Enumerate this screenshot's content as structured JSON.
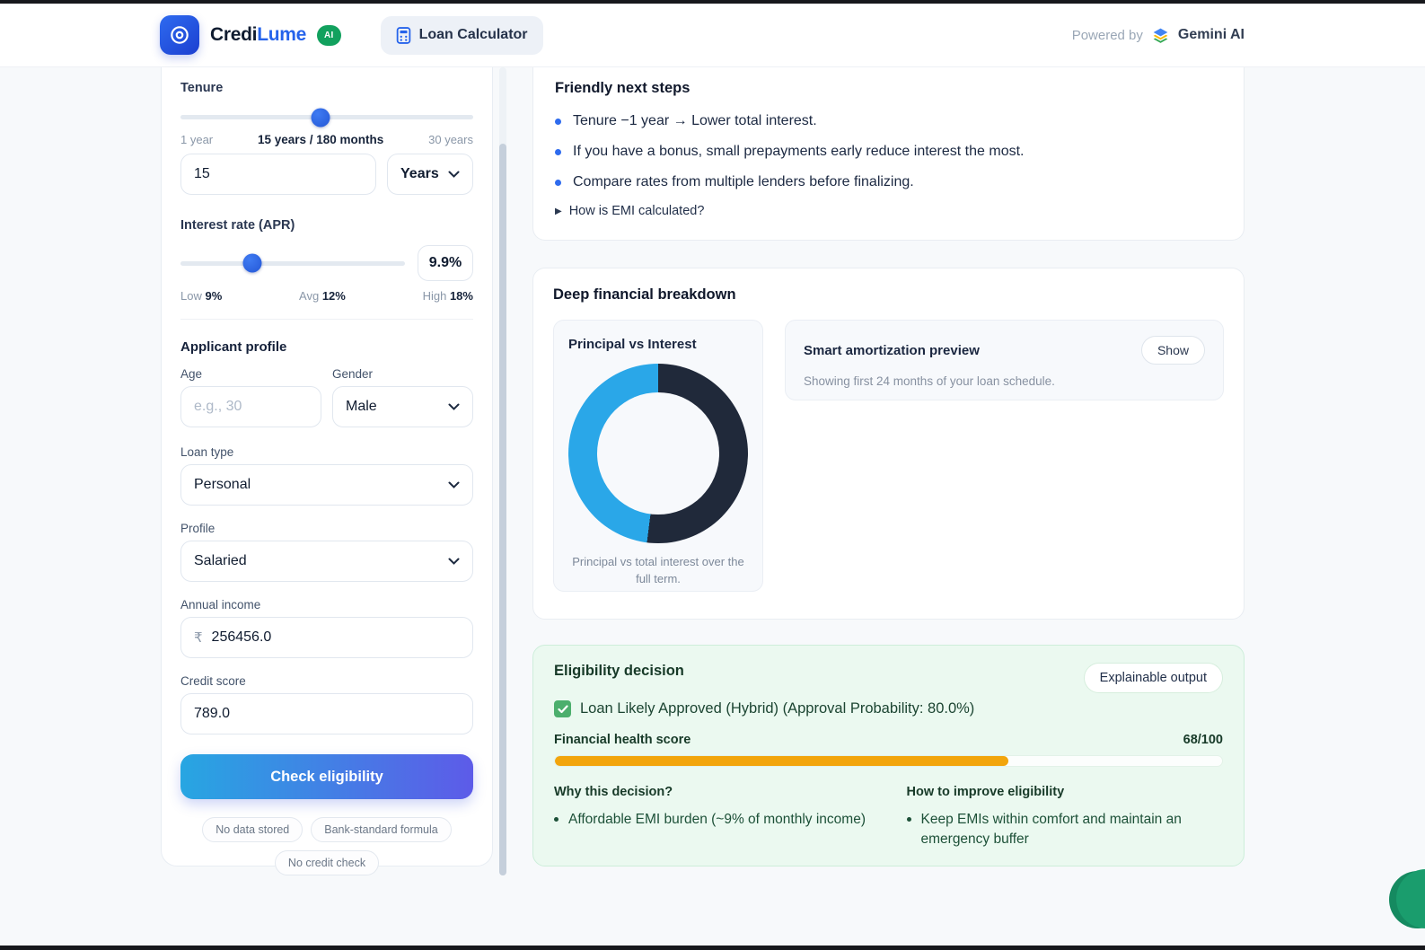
{
  "header": {
    "brand": {
      "name_primary": "Credi",
      "name_secondary": "Lume",
      "badge": "AI"
    },
    "tab": {
      "label": "Loan Calculator"
    },
    "powered_by": {
      "prefix": "Powered by",
      "name": "Gemini AI"
    }
  },
  "panel": {
    "tenure": {
      "label": "Tenure",
      "min_label": "1 year",
      "current_label": "15 years / 180 months",
      "max_label": "30 years",
      "value": "15",
      "unit": "Years",
      "slider_percent": 48
    },
    "interest": {
      "label": "Interest rate (APR)",
      "value": "9.9%",
      "low_label": "Low",
      "low_value": "9%",
      "avg_label": "Avg",
      "avg_value": "12%",
      "high_label": "High",
      "high_value": "18%",
      "slider_percent": 32
    },
    "applicant": {
      "heading": "Applicant profile",
      "age_label": "Age",
      "age_placeholder": "e.g., 30",
      "gender_label": "Gender",
      "gender_value": "Male",
      "loan_type_label": "Loan type",
      "loan_type_value": "Personal",
      "profile_label": "Profile",
      "profile_value": "Salaried",
      "income_label": "Annual income",
      "income_currency": "₹",
      "income_value": "256456.0",
      "credit_label": "Credit score",
      "credit_value": "789.0"
    },
    "submit_label": "Check eligibility",
    "badges": [
      "No data stored",
      "Bank-standard formula",
      "No credit check"
    ]
  },
  "next_steps": {
    "title": "Friendly next steps",
    "items": [
      "Tenure −1 year → Lower total interest.",
      "If you have a bonus, small prepayments early reduce interest the most.",
      "Compare rates from multiple lenders before finalizing."
    ],
    "emi_marker": "▶",
    "emi_question": "How is EMI calculated?"
  },
  "breakdown": {
    "title": "Deep financial breakdown",
    "donut_title": "Principal vs Interest",
    "donut_caption": "Principal vs total interest over the full term.",
    "amortization": {
      "title": "Smart amortization preview",
      "button": "Show",
      "caption": "Showing first 24 months of your loan schedule."
    }
  },
  "chart_data": {
    "type": "pie",
    "title": "Principal vs Interest",
    "labels": [
      "Principal",
      "Total interest"
    ],
    "values": [
      52,
      48
    ],
    "colors": [
      "#20293a",
      "#2aa7e8"
    ],
    "legend": "none",
    "caption": "Principal vs total interest over the full term."
  },
  "eligibility": {
    "title": "Eligibility decision",
    "pill": "Explainable output",
    "result": "Loan Likely Approved (Hybrid) (Approval Probability: 80.0%)",
    "health_label": "Financial health score",
    "health_value": "68/100",
    "health_percent": 68,
    "why": {
      "heading": "Why this decision?",
      "item": "Affordable EMI burden (~9% of monthly income)"
    },
    "improve": {
      "heading": "How to improve eligibility",
      "item": "Keep EMIs within comfort and maintain an emergency buffer"
    }
  },
  "colors": {
    "accent_blue": "#2563eb",
    "chart_blue": "#2aa7e8",
    "chart_dark": "#20293a",
    "progress_orange": "#f2a50c",
    "success_green": "#1a9d6d"
  }
}
